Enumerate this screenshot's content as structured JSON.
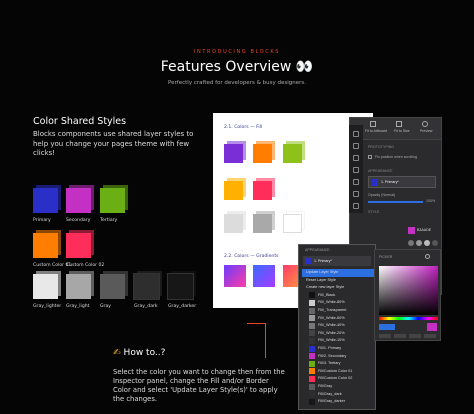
{
  "header": {
    "eyebrow": "INTRODUCING BLOCKS",
    "title": "Features Overview 👀",
    "subtitle": "Perfectly crafted for developers & busy designers."
  },
  "section": {
    "title": "Color Shared Styles",
    "description": "Blocks components use shared layer styles to help you change your pages theme with few clicks!"
  },
  "swatches": [
    {
      "label": "Primary",
      "color": "#2a2fc8"
    },
    {
      "label": "Secondary",
      "color": "#c42fc4"
    },
    {
      "label": "Tertiary",
      "color": "#6ab015"
    },
    {
      "label": "Custom Color 01",
      "color": "#ff7d00"
    },
    {
      "label": "Custom Color 02",
      "color": "#ff2d5a"
    },
    {
      "label": "Gray_lighter",
      "color": "#e8e8e8"
    },
    {
      "label": "Gray_light",
      "color": "#a7a7a7"
    },
    {
      "label": "Gray",
      "color": "#5a5a5a"
    },
    {
      "label": "Gray_dark",
      "color": "#2e2e2e"
    },
    {
      "label": "Gray_darker",
      "color": "#171717"
    }
  ],
  "doc": {
    "h1": "2.1. Colors — Fill",
    "h2": "2.2. Colors — Gradients",
    "fill_colors": [
      "#7a2fd6",
      "#ff7d00",
      "#8ec21a",
      "#ffb000",
      "#ff2d5a",
      "#dcdcdc",
      "#a9a9a9",
      "#ffffff"
    ],
    "gradient_colors": [
      [
        "#6a3cff",
        "#ff3ca5"
      ],
      [
        "#3c6aff",
        "#a53cff"
      ],
      [
        "#ff3c6a",
        "#ff9a3c"
      ]
    ]
  },
  "inspector": {
    "tabs": [
      "Fit to Artboard",
      "Fit to Size",
      "Preview"
    ],
    "prototyping": "PROTOTYPING",
    "fix_position": "Fix position when scrolling",
    "appearance": "APPEARANCE",
    "style_name": "1. Primary*",
    "opacity_label": "Opacity (Normal)",
    "opacity_value": "100%",
    "style_section": "STYLE"
  },
  "menu": {
    "header": "APPEARANCE",
    "current": "1. Primary*",
    "items": [
      {
        "label": "Update Layer Style",
        "color": "",
        "highlight": true
      },
      {
        "label": "Reset Layer Style",
        "color": ""
      },
      {
        "label": "Create new layer Style",
        "color": ""
      },
      {
        "label": "Fill/_Black",
        "color": "#111111"
      },
      {
        "label": "Fill/_White-80%",
        "color": "#cccccc"
      },
      {
        "label": "Fill/_Transparent",
        "color": "#666666"
      },
      {
        "label": "Fill/_White-60%",
        "color": "#999999"
      },
      {
        "label": "Fill/_White-40%",
        "color": "#777777"
      },
      {
        "label": "Fill/_White-20%",
        "color": "#444444"
      },
      {
        "label": "Fill/_White-10%",
        "color": "#333333"
      },
      {
        "label": "Fill/1. Primary",
        "color": "#2a2fc8"
      },
      {
        "label": "Fill/2. Secondary",
        "color": "#c42fc4"
      },
      {
        "label": "Fill/3. Tertiary",
        "color": "#6ab015"
      },
      {
        "label": "Fill/Custom Color 01",
        "color": "#ff7d00"
      },
      {
        "label": "Fill/Custom Color 02",
        "color": "#ff2d5a"
      },
      {
        "label": "Fill/Gray",
        "color": "#5a5a5a"
      },
      {
        "label": "Fill/Gray_dark",
        "color": "#2e2e2e"
      },
      {
        "label": "Fill/Gray_darker",
        "color": "#171717"
      }
    ]
  },
  "picker": {
    "hex": "B3AADE",
    "label": "PICKER"
  },
  "howto": {
    "title": "How to..?",
    "description": "Select the color you want to change then from the Inspector panel, change the Fill and/or Border Color and select 'Update Layer Style(s)' to apply the changes."
  }
}
